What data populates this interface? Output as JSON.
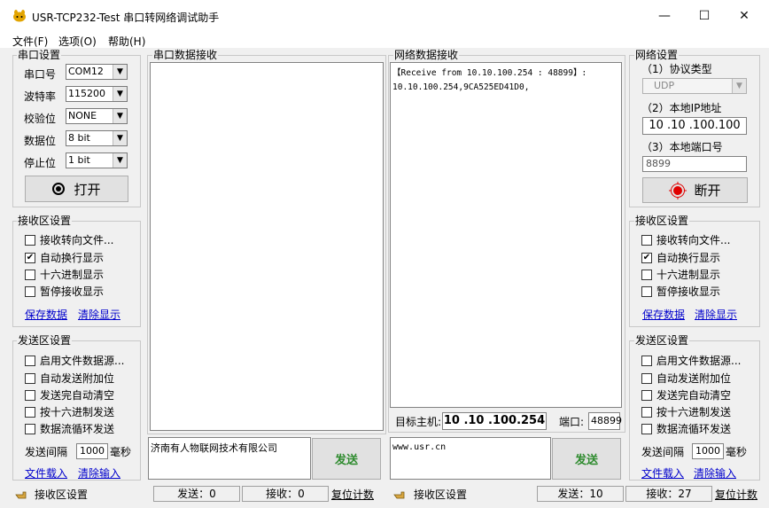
{
  "window": {
    "title": "USR-TCP232-Test 串口转网络调试助手",
    "minimize": "—",
    "maximize": "☐",
    "close": "✕"
  },
  "menu": [
    "文件(F)",
    "选项(O)",
    "帮助(H)"
  ],
  "serial_settings": {
    "title": "串口设置",
    "port_label": "串口号",
    "port_value": "COM12",
    "baud_label": "波特率",
    "baud_value": "115200",
    "parity_label": "校验位",
    "parity_value": "NONE",
    "databits_label": "数据位",
    "databits_value": "8 bit",
    "stopbits_label": "停止位",
    "stopbits_value": "1 bit",
    "open_button": "打开"
  },
  "left_recv_settings": {
    "title": "接收区设置",
    "options": [
      {
        "label": "接收转向文件...",
        "checked": false
      },
      {
        "label": "自动换行显示",
        "checked": true
      },
      {
        "label": "十六进制显示",
        "checked": false
      },
      {
        "label": "暂停接收显示",
        "checked": false
      }
    ],
    "save_link": "保存数据",
    "clear_link": "清除显示"
  },
  "left_send_settings": {
    "title": "发送区设置",
    "options": [
      {
        "label": "启用文件数据源...",
        "checked": false
      },
      {
        "label": "自动发送附加位",
        "checked": false
      },
      {
        "label": "发送完自动清空",
        "checked": false
      },
      {
        "label": "按十六进制发送",
        "checked": false
      },
      {
        "label": "数据流循环发送",
        "checked": false
      }
    ],
    "interval_label": "发送间隔",
    "interval_value": "1000",
    "interval_unit": "毫秒",
    "load_link": "文件载入",
    "clear_link": "清除输入"
  },
  "serial_recv": {
    "title": "串口数据接收"
  },
  "net_recv": {
    "title": "网络数据接收",
    "lines": [
      "【Receive from 10.10.100.254 : 48899】:",
      "10.10.100.254,9CA525ED41D0,"
    ]
  },
  "target": {
    "host_label": "目标主机:",
    "host_value": "10 .10 .100.254",
    "port_label": "端口:",
    "port_value": "48899"
  },
  "serial_send": {
    "text": "济南有人物联网技术有限公司",
    "button": "发送"
  },
  "net_send": {
    "text": "www.usr.cn",
    "button": "发送"
  },
  "net_settings": {
    "title": "网络设置",
    "protocol_label": "（1）协议类型",
    "protocol_value": "UDP",
    "ip_label": "（2）本地IP地址",
    "ip_value": "10 .10 .100.100",
    "port_label": "（3）本地端口号",
    "port_value": "8899",
    "disconnect_button": "断开"
  },
  "right_recv_settings": {
    "title": "接收区设置",
    "options": [
      {
        "label": "接收转向文件...",
        "checked": false
      },
      {
        "label": "自动换行显示",
        "checked": true
      },
      {
        "label": "十六进制显示",
        "checked": false
      },
      {
        "label": "暂停接收显示",
        "checked": false
      }
    ],
    "save_link": "保存数据",
    "clear_link": "清除显示"
  },
  "right_send_settings": {
    "title": "发送区设置",
    "options": [
      {
        "label": "启用文件数据源...",
        "checked": false
      },
      {
        "label": "自动发送附加位",
        "checked": false
      },
      {
        "label": "发送完自动清空",
        "checked": false
      },
      {
        "label": "按十六进制发送",
        "checked": false
      },
      {
        "label": "数据流循环发送",
        "checked": false
      }
    ],
    "interval_label": "发送间隔",
    "interval_value": "1000",
    "interval_unit": "毫秒",
    "load_link": "文件载入",
    "clear_link": "清除输入"
  },
  "status_left": {
    "recv_settings": "接收区设置",
    "sent": "发送：0",
    "received": "接收：0",
    "reset": "复位计数"
  },
  "status_right": {
    "recv_settings": "接收区设置",
    "sent": "发送：10",
    "received": "接收：27",
    "reset": "复位计数"
  },
  "colors": {
    "send_button_text": "#2e8b2e",
    "link": "#0000cc",
    "disconnect_icon": "#e00000"
  },
  "icons": {
    "app": "rabbit-head-icon",
    "status": "hand-pointer-icon"
  }
}
